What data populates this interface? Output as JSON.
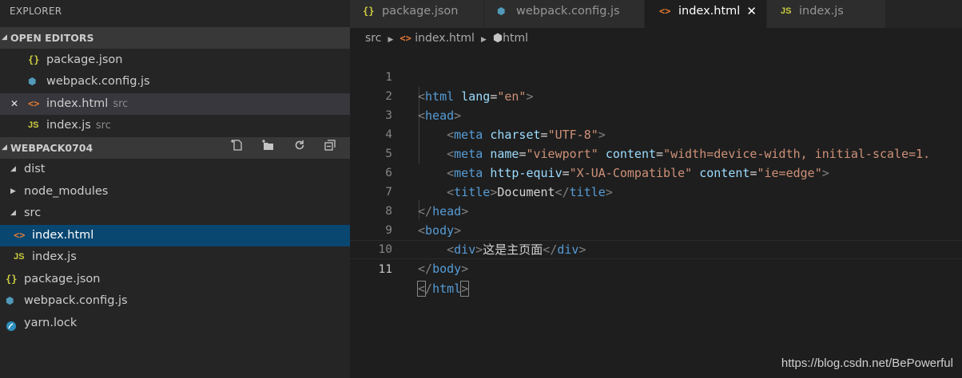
{
  "explorer": {
    "title": "EXPLORER",
    "open_editors": {
      "header": "OPEN EDITORS",
      "items": [
        {
          "icon": "{}",
          "name": "package.json",
          "desc": ""
        },
        {
          "icon": "⬢",
          "name": "webpack.config.js",
          "desc": ""
        },
        {
          "icon": "<>",
          "name": "index.html",
          "desc": "src"
        },
        {
          "icon": "JS",
          "name": "index.js",
          "desc": "src"
        }
      ]
    },
    "project": {
      "header": "WEBPACK0704",
      "tree": [
        {
          "icon": "",
          "name": "dist"
        },
        {
          "icon": "",
          "name": "node_modules"
        },
        {
          "icon": "",
          "name": "src"
        },
        {
          "icon": "<>",
          "name": "index.html"
        },
        {
          "icon": "JS",
          "name": "index.js"
        },
        {
          "icon": "{}",
          "name": "package.json"
        },
        {
          "icon": "⬢",
          "name": "webpack.config.js"
        },
        {
          "icon": "",
          "name": "yarn.lock"
        }
      ]
    }
  },
  "tabs": [
    {
      "icon": "{}",
      "label": "package.json"
    },
    {
      "icon": "⬢",
      "label": "webpack.config.js"
    },
    {
      "icon": "<>",
      "label": "index.html",
      "close": "✕"
    },
    {
      "icon": "JS",
      "label": "index.js"
    }
  ],
  "breadcrumb": [
    "src",
    "index.html",
    "html"
  ],
  "code": {
    "lines": [
      "1",
      "2",
      "3",
      "4",
      "5",
      "6",
      "7",
      "8",
      "9",
      "10",
      "11"
    ],
    "current_line": "11"
  },
  "colors": {
    "tag_bracket": "#808080",
    "tag_name": "#569cd6",
    "attr_name": "#9cdcfe",
    "attr_value": "#ce9178",
    "text": "#d4d4d4",
    "selection": "#094771"
  },
  "watermark": "https://blog.csdn.net/BePowerful"
}
